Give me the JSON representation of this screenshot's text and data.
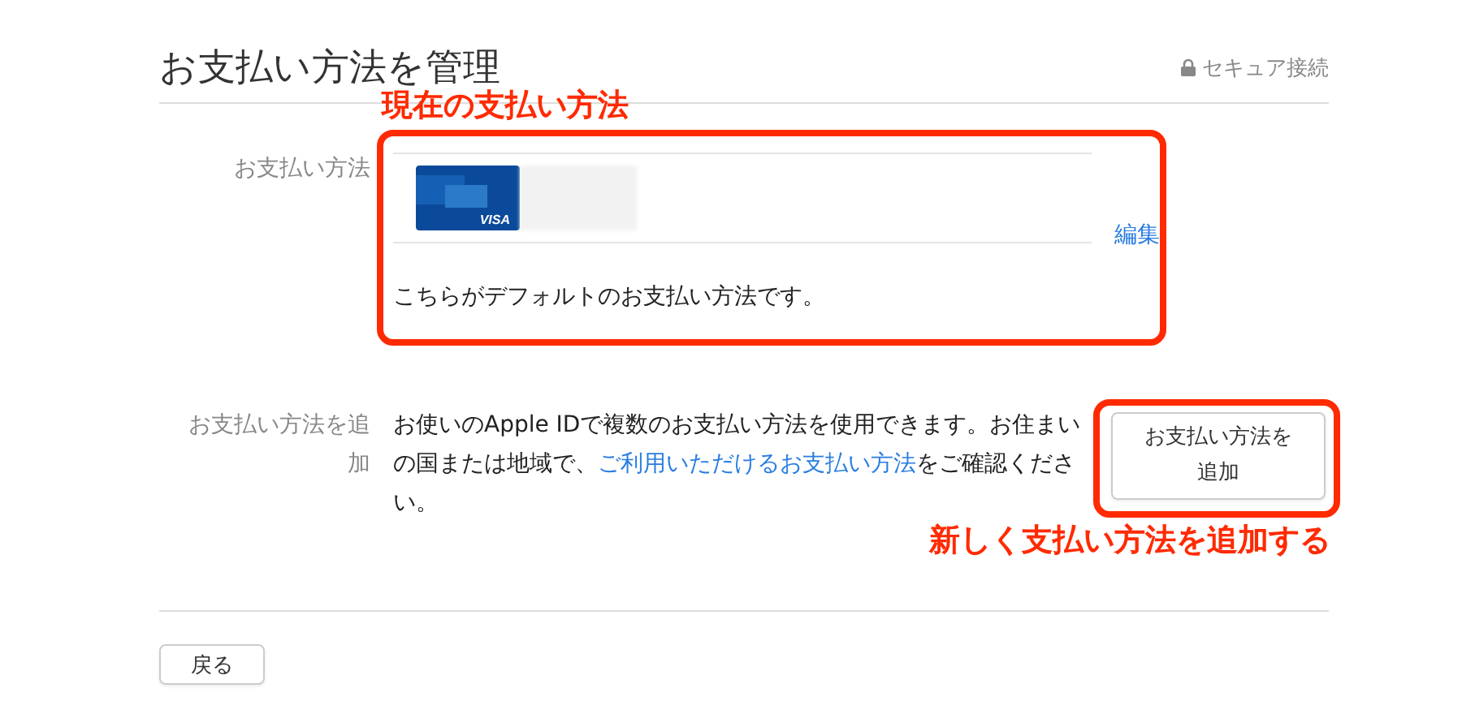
{
  "header": {
    "title": "お支払い方法を管理",
    "secure_label": "セキュア接続"
  },
  "current_method": {
    "label": "お支払い方法",
    "card_brand": "VISA",
    "edit_link": "編集",
    "note": "こちらがデフォルトのお支払い方法です。"
  },
  "add_method": {
    "label": "お支払い方法を追加",
    "text_before": "お使いのApple IDで複数のお支払い方法を使用できます。お住まいの国または地域で、",
    "link": "ご利用いただけるお支払い方法",
    "text_after": "をご確認ください。",
    "button": "お支払い方法を追加"
  },
  "back_button": "戻る",
  "annotations": [
    {
      "text": "現在の支払い方法"
    },
    {
      "text": "新しく支払い方法を追加する"
    }
  ]
}
